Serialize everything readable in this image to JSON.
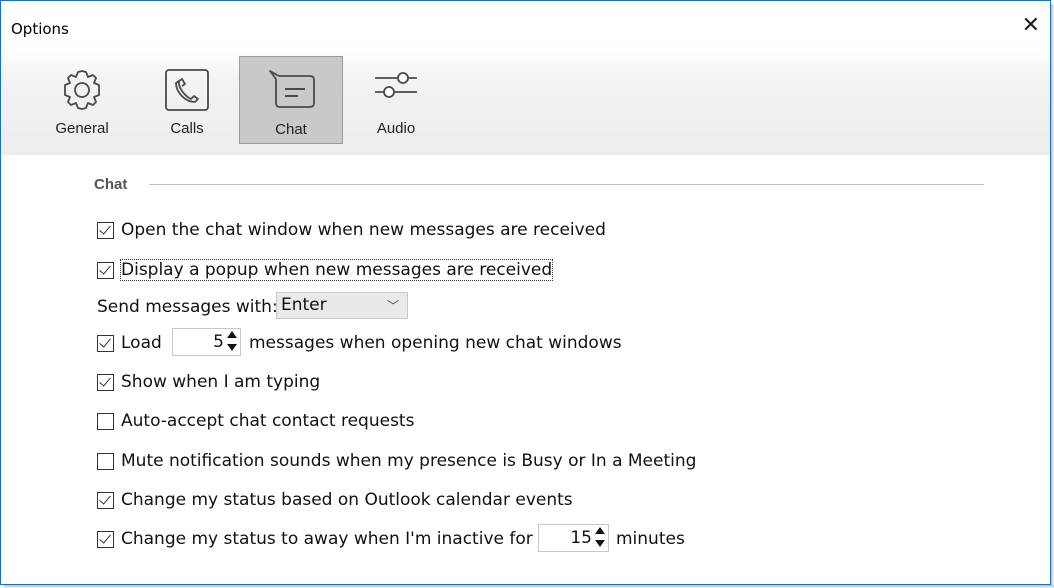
{
  "window": {
    "title": "Options"
  },
  "toolbar": {
    "items": [
      {
        "label": "General",
        "icon": "gear-icon",
        "selected": false
      },
      {
        "label": "Calls",
        "icon": "phone-icon",
        "selected": false
      },
      {
        "label": "Chat",
        "icon": "chat-bubble-icon",
        "selected": true
      },
      {
        "label": "Audio",
        "icon": "sliders-icon",
        "selected": false
      }
    ]
  },
  "section": {
    "title": "Chat"
  },
  "options": {
    "open_chat": {
      "label": "Open the chat window when new messages are received",
      "checked": true
    },
    "popup": {
      "label": "Display a popup when new messages are received",
      "checked": true
    },
    "send_with": {
      "label": "Send messages with:",
      "value": "Enter"
    },
    "load": {
      "prefix": "Load",
      "value": "5",
      "suffix": "messages when opening new chat windows",
      "checked": true
    },
    "typing": {
      "label": "Show when I am typing",
      "checked": true
    },
    "auto_accept": {
      "label": "Auto-accept chat contact requests",
      "checked": false
    },
    "mute": {
      "label": "Mute notification sounds when my presence is Busy or In a Meeting",
      "checked": false
    },
    "outlook": {
      "label": "Change my status based on Outlook calendar events",
      "checked": true
    },
    "away": {
      "prefix": "Change my status to away when I'm inactive for",
      "value": "15",
      "suffix": "minutes",
      "checked": true
    }
  },
  "colors": {
    "accent_border": "#1e6fb8",
    "selected_tab": "#c9c9c9",
    "icon_stroke": "#4a4a4a"
  }
}
